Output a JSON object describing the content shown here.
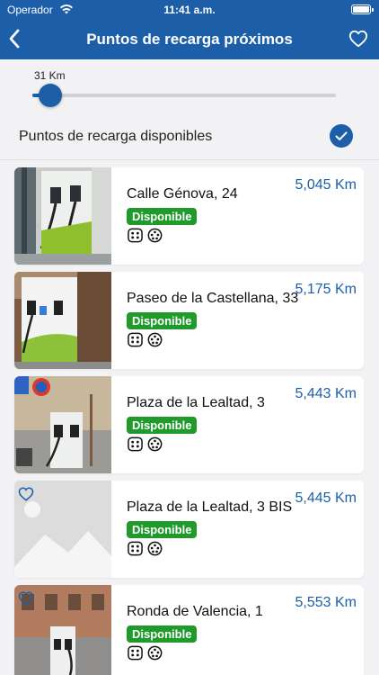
{
  "status_bar": {
    "carrier": "Operador",
    "time": "11:41 a.m."
  },
  "nav": {
    "title": "Puntos de recarga próximos",
    "back_icon": "chevron-left-icon",
    "favorite_icon": "heart-outline-icon"
  },
  "filters": {
    "distance_label": "31 Km",
    "distance_fraction": 0.06,
    "available_label": "Puntos de recarga disponibles",
    "available_checked": true
  },
  "colors": {
    "primary": "#1c5fa8",
    "available_badge": "#1f9a2b",
    "background": "#f2f2f4"
  },
  "stations": [
    {
      "title": "Calle Génova, 24",
      "distance": "5,045 Km",
      "status": "Disponible",
      "favorite_icon": false,
      "image": "photo-charger-white-green"
    },
    {
      "title": "Paseo de la Castellana, 33",
      "distance": "5,175 Km",
      "status": "Disponible",
      "favorite_icon": false,
      "image": "photo-charger-green-stripe"
    },
    {
      "title": "Plaza de la Lealtad, 3",
      "distance": "5,443 Km",
      "status": "Disponible",
      "favorite_icon": false,
      "image": "photo-charger-street"
    },
    {
      "title": "Plaza de la Lealtad, 3 BIS",
      "distance": "5,445 Km",
      "status": "Disponible",
      "favorite_icon": true,
      "image": "placeholder-image"
    },
    {
      "title": "Ronda de Valencia, 1",
      "distance": "5,553 Km",
      "status": "Disponible",
      "favorite_icon": true,
      "image": "photo-charger-building"
    }
  ]
}
